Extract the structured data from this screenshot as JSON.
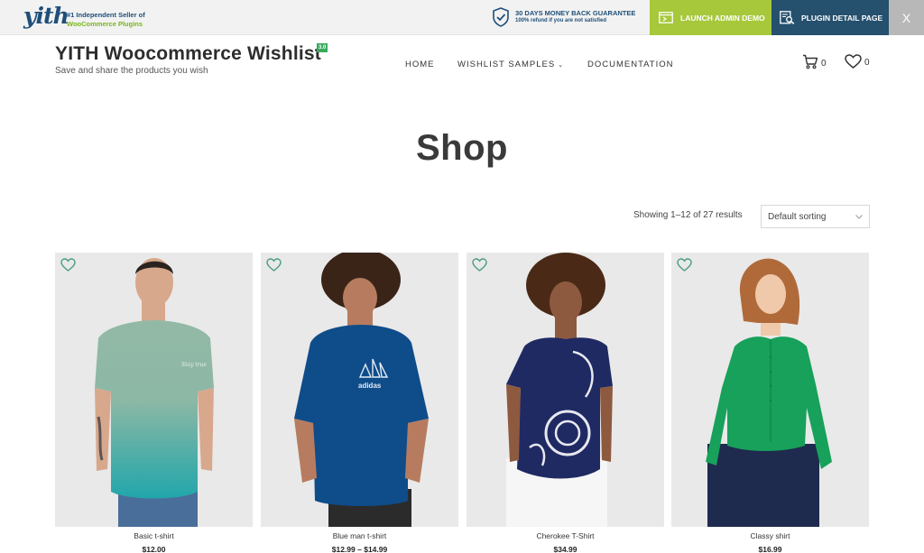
{
  "promo": {
    "logo": "yith",
    "tagline_1": "#1 Independent Seller of",
    "tagline_2": "WooCommerce Plugins",
    "guarantee_title": "30 DAYS MONEY BACK GUARANTEE",
    "guarantee_sub": "100% refund if you are not satisfied",
    "demo_label": "LAUNCH ADMIN DEMO",
    "detail_label": "PLUGIN DETAIL PAGE",
    "close_label": "X",
    "colors": {
      "demo_bg": "#a7c83b",
      "detail_bg": "#25506e",
      "brand": "#1f4f7a"
    }
  },
  "header": {
    "title": "YITH Woocommerce Wishlist",
    "version": "3.0",
    "description": "Save and share the products you wish",
    "nav": [
      "HOME",
      "WISHLIST SAMPLES",
      "DOCUMENTATION"
    ],
    "cart_count": "0",
    "wishlist_count": "0"
  },
  "page": {
    "title": "Shop",
    "result_count": "Showing 1–12 of 27 results",
    "sorting": "Default sorting"
  },
  "products": [
    {
      "name": "Basic t-shirt",
      "price": "$12.00",
      "shirt_color": "#8fb9a4",
      "bottom_color": "#2aa6a8",
      "pants_color": "#4a6e9a",
      "hair_color": "#2a2320",
      "skin": "#d7a88c"
    },
    {
      "name": "Blue man t-shirt",
      "price": "$12.99 – $14.99",
      "shirt_color": "#0f4c8a",
      "pants_color": "#2b2b2b",
      "hair_color": "#3a2418",
      "skin": "#b77c5f"
    },
    {
      "name": "Cherokee T-Shirt",
      "price": "$34.99",
      "shirt_color": "#1f2a63",
      "pants_color": "#f6f6f6",
      "hair_color": "#4a2a16",
      "skin": "#8d5a40"
    },
    {
      "name": "Classy shirt",
      "price": "$16.99",
      "shirt_color": "#17a15a",
      "pants_color": "#1f2a4f",
      "hair_color": "#b06a3a",
      "skin": "#f0c9aa"
    }
  ]
}
